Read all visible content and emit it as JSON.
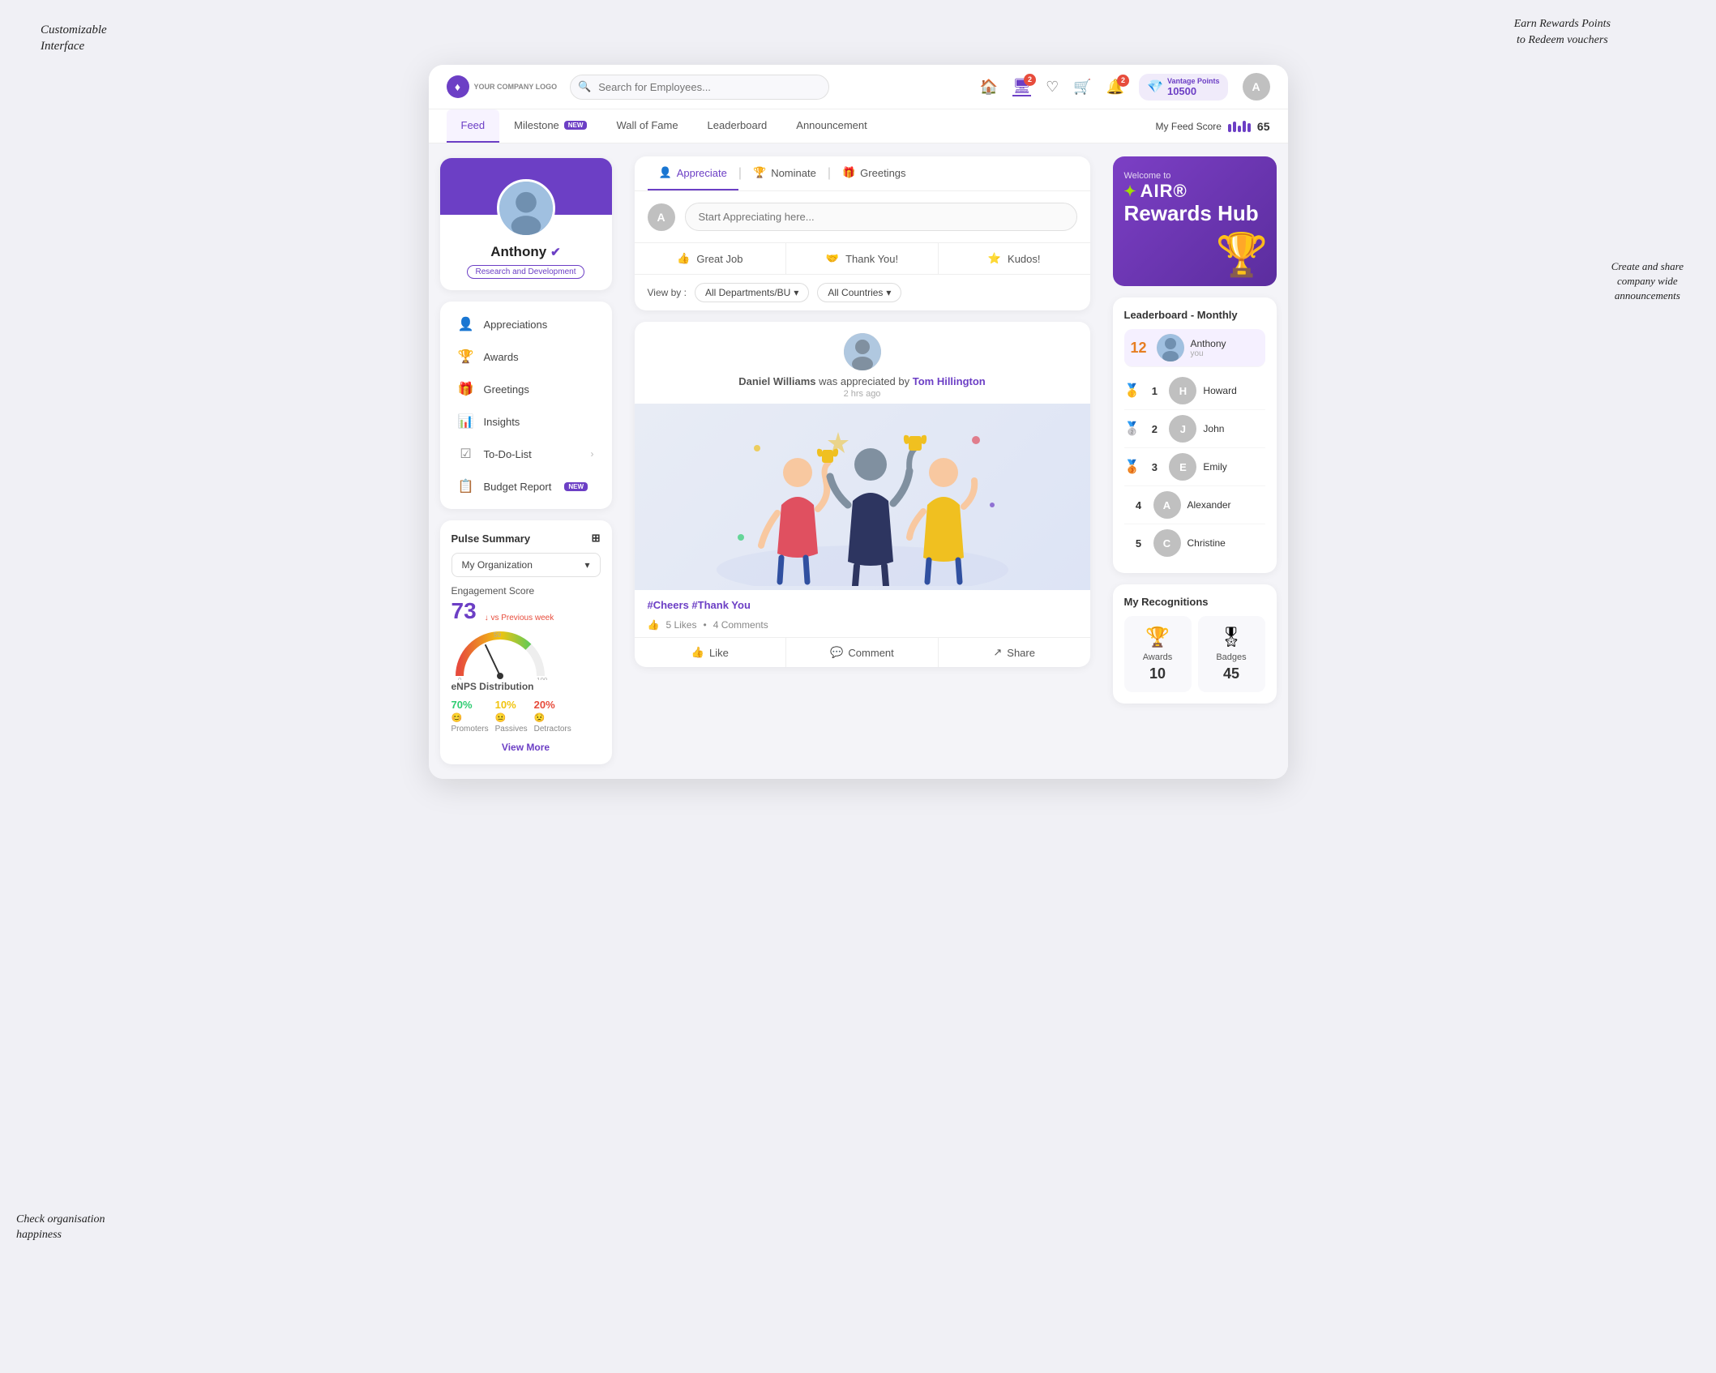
{
  "annotations": {
    "customizable": "Customizable\nInterface",
    "earn_rewards": "Earn Rewards Points\nto Redeem vouchers",
    "create_share": "Create and share\ncompany wide\nannouncements",
    "check_org": "Check organisation\nhappiness"
  },
  "logo": {
    "icon": "♦",
    "text": "YOUR\nCOMPANY\nLOGO"
  },
  "search": {
    "placeholder": "Search for Employees..."
  },
  "nav_icons": {
    "home": "🏠",
    "monitor": "🖥",
    "heart": "♡",
    "cart": "🛒",
    "bell": "🔔"
  },
  "badges": {
    "bell": "2",
    "monitor": "2"
  },
  "vantage": {
    "label": "Vantage Points",
    "value": "10500"
  },
  "second_nav": {
    "tabs": [
      {
        "id": "feed",
        "label": "Feed",
        "active": true,
        "badge": null
      },
      {
        "id": "milestone",
        "label": "Milestone",
        "active": false,
        "badge": "NEW"
      },
      {
        "id": "wall-of-fame",
        "label": "Wall of Fame",
        "active": false,
        "badge": null
      },
      {
        "id": "leaderboard",
        "label": "Leaderboard",
        "active": false,
        "badge": null
      },
      {
        "id": "announcement",
        "label": "Announcement",
        "active": false,
        "badge": null
      }
    ],
    "feed_score_label": "My Feed Score",
    "feed_score_value": "65"
  },
  "profile": {
    "name": "Anthony",
    "verified": true,
    "department": "Research and Development"
  },
  "sidebar_menu": [
    {
      "id": "appreciations",
      "icon": "👤",
      "label": "Appreciations"
    },
    {
      "id": "awards",
      "icon": "🏆",
      "label": "Awards"
    },
    {
      "id": "greetings",
      "icon": "🎁",
      "label": "Greetings"
    },
    {
      "id": "insights",
      "icon": "📊",
      "label": "Insights"
    },
    {
      "id": "todo",
      "icon": "☑",
      "label": "To-Do-List",
      "arrow": true
    },
    {
      "id": "budget",
      "icon": "📋",
      "label": "Budget Report",
      "badge": "NEW"
    }
  ],
  "pulse": {
    "title": "Pulse Summary",
    "dropdown": "My Organization",
    "engagement_label": "Engagement Score",
    "score": "73",
    "vs_prev": "vs Previous week",
    "enps_title": "eNPS Distribution",
    "promoters_pct": "70%",
    "promoters_label": "Promoters",
    "passives_pct": "10%",
    "passives_label": "Passives",
    "detractors_pct": "20%",
    "detractors_label": "Detractors",
    "view_more": "View More"
  },
  "post_composer": {
    "tabs": [
      {
        "id": "appreciate",
        "icon": "👤",
        "label": "Appreciate",
        "active": true
      },
      {
        "id": "nominate",
        "icon": "🏆",
        "label": "Nominate",
        "active": false
      },
      {
        "id": "greetings",
        "icon": "🎁",
        "label": "Greetings",
        "active": false
      }
    ],
    "placeholder": "Start Appreciating here...",
    "quick_actions": [
      {
        "id": "great-job",
        "icon": "👍",
        "label": "Great Job"
      },
      {
        "id": "thank-you",
        "icon": "🤝",
        "label": "Thank You!"
      },
      {
        "id": "kudos",
        "icon": "⭐",
        "label": "Kudos!"
      }
    ]
  },
  "filter": {
    "label": "View by :",
    "dept": "All Departments/BU",
    "country": "All Countries"
  },
  "feed_post": {
    "author": "Daniel Williams",
    "appreciated_by": "Tom Hillington",
    "time": "2 hrs ago",
    "tags": "#Cheers #Thank You",
    "likes": "5 Likes",
    "comments": "4 Comments",
    "actions": [
      "Like",
      "Comment",
      "Share"
    ]
  },
  "rewards_hub": {
    "welcome": "Welcome to",
    "air": "AIR®",
    "hub": "Rewards Hub"
  },
  "leaderboard": {
    "title": "Leaderboard - Monthly",
    "highlight": {
      "rank": "12",
      "name": "Anthony",
      "sublabel": "you"
    },
    "items": [
      {
        "rank": "1",
        "name": "Howard",
        "medal": "🥇"
      },
      {
        "rank": "2",
        "name": "John",
        "medal": "🥈"
      },
      {
        "rank": "3",
        "name": "Emily",
        "medal": "🥉"
      },
      {
        "rank": "4",
        "name": "Alexander",
        "medal": ""
      },
      {
        "rank": "5",
        "name": "Christine",
        "medal": ""
      }
    ]
  },
  "recognitions": {
    "title": "My Recognitions",
    "items": [
      {
        "id": "awards",
        "icon": "🏆",
        "label": "Awards",
        "count": "10"
      },
      {
        "id": "badges",
        "icon": "🎖",
        "label": "Badges",
        "count": "45"
      }
    ]
  }
}
